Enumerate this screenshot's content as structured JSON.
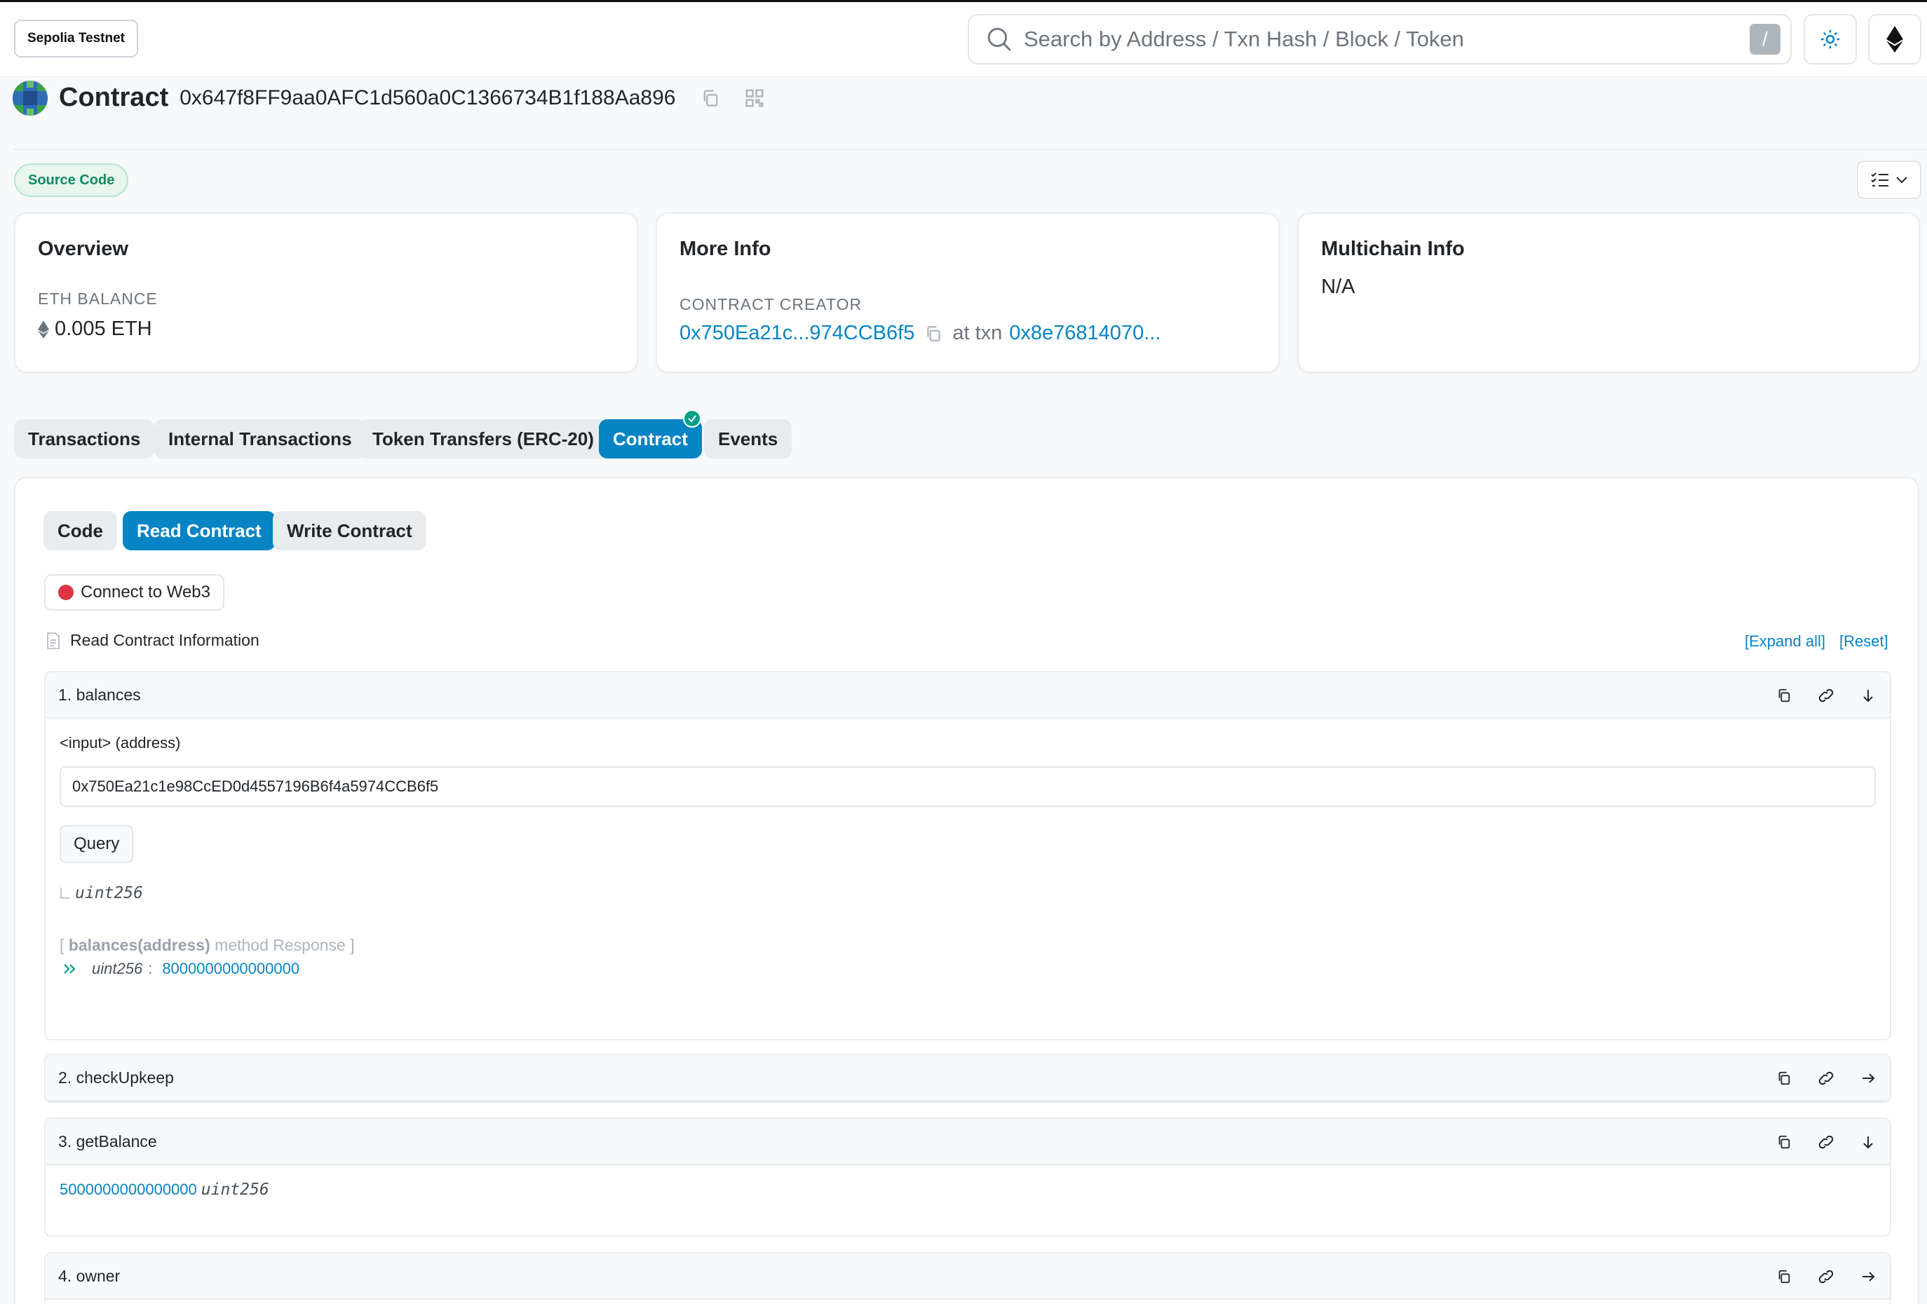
{
  "header": {
    "network": "Sepolia Testnet",
    "search_placeholder": "Search by Address / Txn Hash / Block / Token",
    "search_shortcut": "/"
  },
  "contract": {
    "label": "Contract",
    "address": "0x647f8FF9aa0AFC1d560a0C1366734B1f188Aa896"
  },
  "source_badge": "Source Code",
  "overview": {
    "title": "Overview",
    "balance_label": "ETH BALANCE",
    "balance_value": "0.005 ETH"
  },
  "more_info": {
    "title": "More Info",
    "creator_label": "CONTRACT CREATOR",
    "creator_address": "0x750Ea21c...974CCB6f5",
    "at_txn": "at txn",
    "txn_hash": "0x8e76814070..."
  },
  "multichain": {
    "title": "Multichain Info",
    "value": "N/A"
  },
  "tabs": [
    "Transactions",
    "Internal Transactions",
    "Token Transfers (ERC-20)",
    "Contract",
    "Events"
  ],
  "subtabs": [
    "Code",
    "Read Contract",
    "Write Contract"
  ],
  "connect_label": "Connect to Web3",
  "read_info_label": "Read Contract Information",
  "expand_all": "[Expand all]",
  "reset": "[Reset]",
  "functions": [
    {
      "title": "1. balances",
      "input_label": "<input> (address)",
      "input_value": "0x750Ea21c1e98CcED0d4557196B6f4a5974CCB6f5",
      "query_label": "Query",
      "return_type": "uint256",
      "response_open": "[",
      "response_method": "balances(address)",
      "response_suffix": "method Response ]",
      "response_type": "uint256",
      "response_sep": ":",
      "response_value": "8000000000000000"
    },
    {
      "title": "2. checkUpkeep"
    },
    {
      "title": "3. getBalance",
      "value": "5000000000000000",
      "type": "uint256"
    },
    {
      "title": "4. owner"
    }
  ],
  "colors": {
    "link": "#0784c3",
    "active_tab": "#0784c3",
    "success": "#00a186",
    "disconnected": "#dc3545"
  }
}
